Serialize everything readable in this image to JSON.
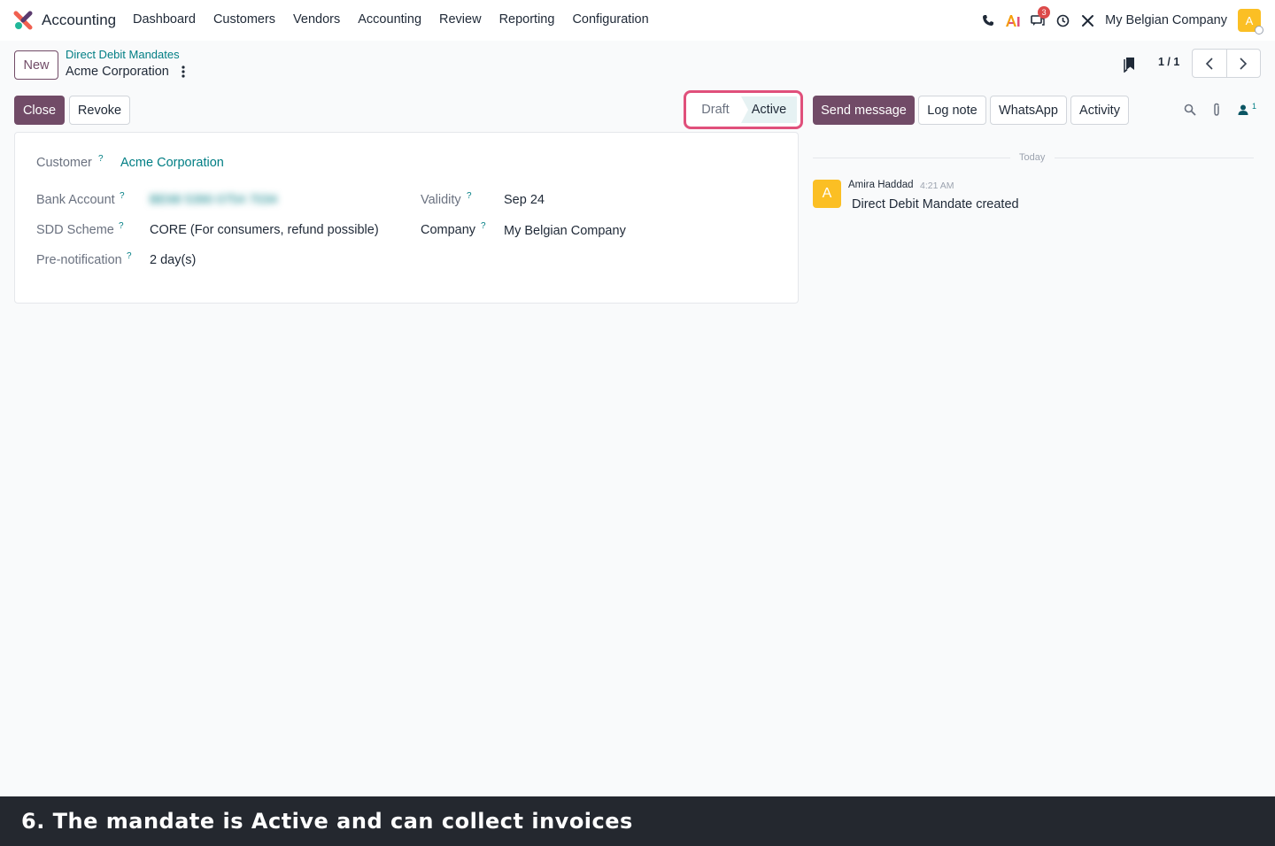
{
  "app": {
    "name": "Accounting",
    "menu": [
      "Dashboard",
      "Customers",
      "Vendors",
      "Accounting",
      "Review",
      "Reporting",
      "Configuration"
    ],
    "messages_badge": "3",
    "company": "My Belgian Company",
    "user_initial": "A"
  },
  "control_panel": {
    "new_label": "New",
    "breadcrumb_parent": "Direct Debit Mandates",
    "record_title": "Acme Corporation",
    "pager_value": "1 / 1"
  },
  "actions": {
    "close_label": "Close",
    "revoke_label": "Revoke"
  },
  "status": {
    "stages": [
      "Draft",
      "Active"
    ],
    "current": "Active"
  },
  "chatter_actions": {
    "send_message": "Send message",
    "log_note": "Log note",
    "whatsapp": "WhatsApp",
    "activity": "Activity",
    "followers_count": "1"
  },
  "form": {
    "customer_label": "Customer",
    "customer_value": "Acme Corporation",
    "bank_account_label": "Bank Account",
    "bank_account_value": "BE68 5390 0754 7034",
    "sdd_scheme_label": "SDD Scheme",
    "sdd_scheme_value": "CORE (For consumers, refund possible)",
    "prenotification_label": "Pre-notification",
    "prenotification_value": "2 day(s)",
    "validity_label": "Validity",
    "validity_value": "Sep 24",
    "company_label": "Company",
    "company_value": "My Belgian Company",
    "help_mark": "?"
  },
  "chatter": {
    "day_separator": "Today",
    "messages": [
      {
        "avatar_initial": "A",
        "author": "Amira Haddad",
        "time": "4:21 AM",
        "body": "Direct Debit Mandate created"
      }
    ]
  },
  "caption": "6. The mandate is Active and can collect invoices",
  "colors": {
    "brand_purple": "#714b67",
    "link_teal": "#017e84",
    "highlight_pink": "#e0507b",
    "avatar_yellow": "#fbbf24",
    "caption_bg": "#24282f"
  }
}
